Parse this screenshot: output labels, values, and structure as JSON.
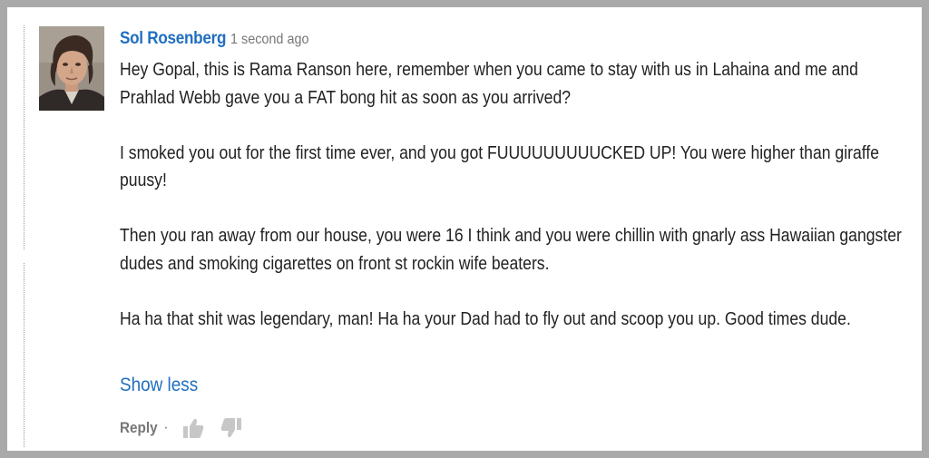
{
  "comment": {
    "author": "Sol Rosenberg",
    "timestamp": "1 second ago",
    "paragraphs": [
      "Hey Gopal, this is Rama Ranson here, remember when you came to stay with us in Lahaina and me and Prahlad Webb gave you a FAT bong hit as soon as you arrived?",
      "I smoked you out for the first time ever, and you got FUUUUUUUUUCKED UP! You were higher than giraffe puusy!",
      "Then you ran away from our house, you were 16 I think and you were chillin with gnarly ass Hawaiian gangster dudes and smoking cigarettes on front st rockin wife beaters.",
      "Ha ha that shit was legendary, man! Ha ha your Dad had to fly out and scoop you up. Good times dude."
    ],
    "show_less_label": "Show less"
  },
  "actions": {
    "reply_label": "Reply",
    "separator": "·",
    "like_icon": "thumbs-up-icon",
    "dislike_icon": "thumbs-down-icon"
  },
  "colors": {
    "link_blue": "#1f6fc0",
    "muted_gray": "#767676",
    "text": "#222222",
    "frame_border": "#a9a9a9"
  }
}
